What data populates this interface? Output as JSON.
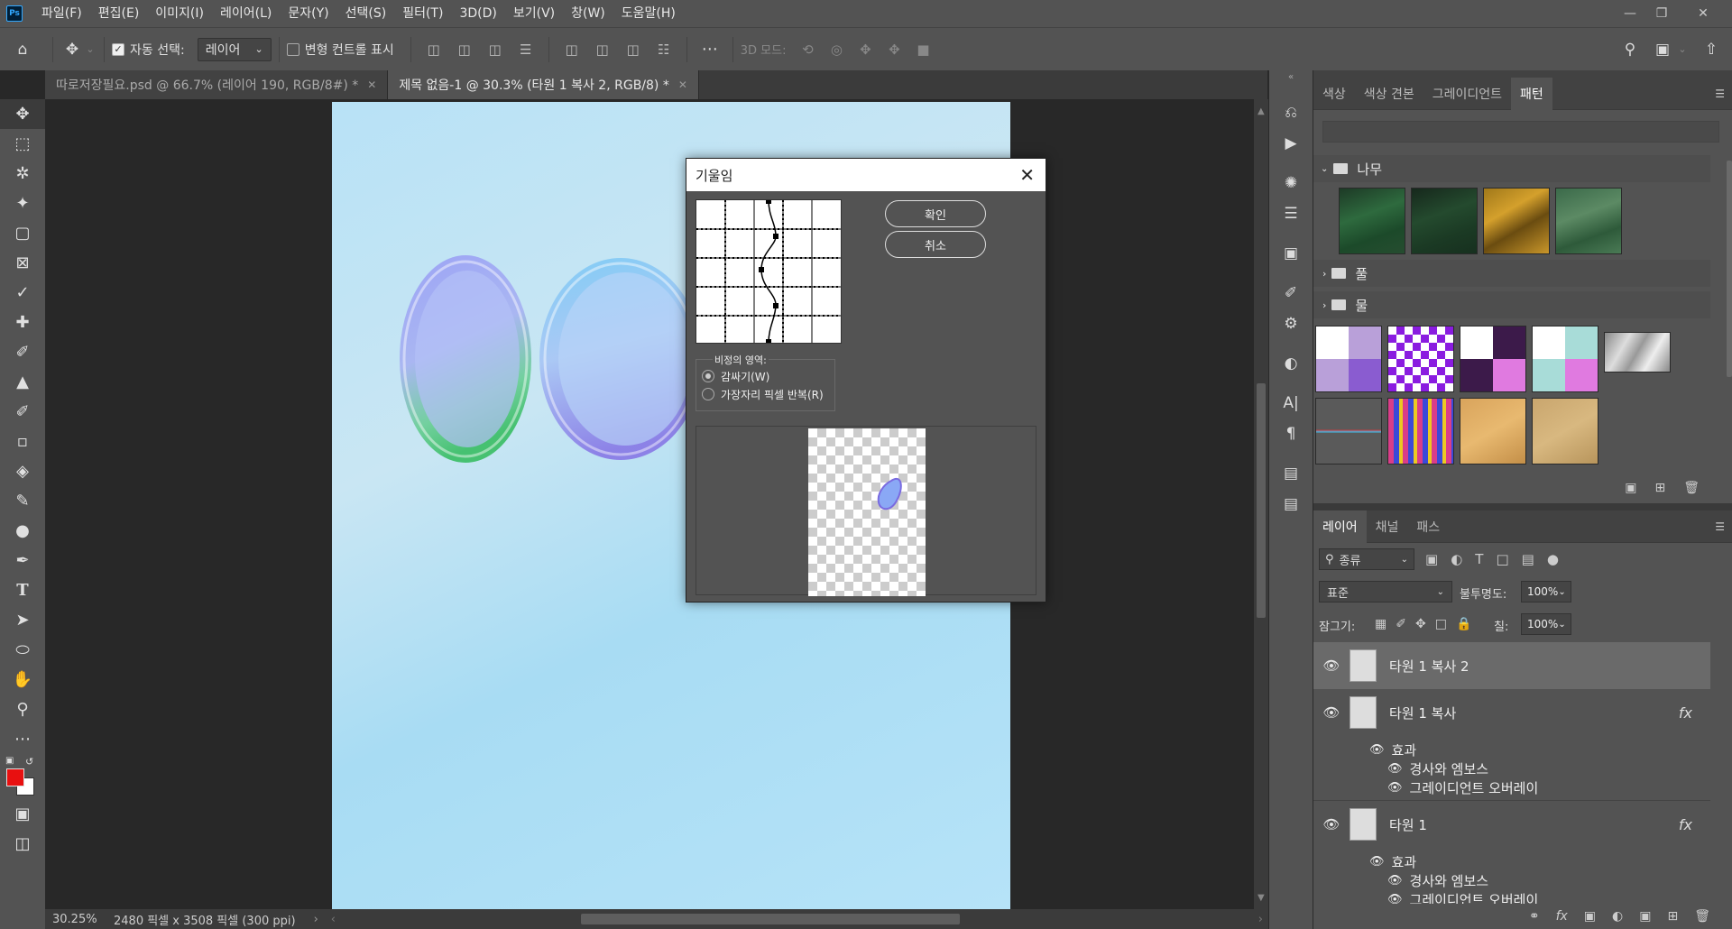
{
  "menubar": {
    "logo": "Ps",
    "items": [
      "파일(F)",
      "편집(E)",
      "이미지(I)",
      "레이어(L)",
      "문자(Y)",
      "선택(S)",
      "필터(T)",
      "3D(D)",
      "보기(V)",
      "창(W)",
      "도움말(H)"
    ]
  },
  "options": {
    "auto_select_label": "자동 선택:",
    "auto_select_value": "레이어",
    "transform_controls_label": "변형 컨트롤 표시",
    "mode_3d_label": "3D 모드:"
  },
  "tabs": [
    {
      "label": "따로저장필요.psd @ 66.7% (레이어 190, RGB/8#) *",
      "active": false
    },
    {
      "label": "제목 없음-1 @ 30.3% (타원 1 복사 2, RGB/8) *",
      "active": true
    }
  ],
  "status": {
    "zoom": "30.25%",
    "doc_info": "2480 픽셀 x 3508 픽셀 (300 ppi)"
  },
  "colors": {
    "foreground": "#e81010",
    "background": "#ffffff"
  },
  "dialog": {
    "title": "기울임",
    "ok_label": "확인",
    "cancel_label": "취소",
    "undefined_area_legend": "비정의 영역:",
    "option_wrap": "감싸기(W)",
    "option_repeat": "가장자리 픽셀 반복(R)",
    "selected_option": "감싸기(W)"
  },
  "swatch_panel": {
    "tabs": [
      "색상",
      "색상 견본",
      "그레이디언트",
      "패턴"
    ],
    "active_tab": "패턴",
    "groups": [
      "나무",
      "풀",
      "물"
    ]
  },
  "layers_panel": {
    "tabs": [
      "레이어",
      "채널",
      "패스"
    ],
    "active_tab": "레이어",
    "filter_label": "종류",
    "blend_mode": "표준",
    "opacity_label": "불투명도:",
    "opacity_value": "100%",
    "lock_label": "잠그기:",
    "fill_label": "칠:",
    "fill_value": "100%",
    "layers": [
      {
        "name": "타원 1 복사 2",
        "selected": true,
        "fx": ""
      },
      {
        "name": "타원 1 복사",
        "selected": false,
        "fx": "fx",
        "effects_label": "효과",
        "effects": [
          "경사와 엠보스",
          "그레이디언트 오버레이"
        ]
      },
      {
        "name": "타원 1",
        "selected": false,
        "fx": "fx",
        "effects_label": "효과",
        "effects": [
          "경사와 엠보스",
          "그레이디언트 오버레이"
        ]
      }
    ]
  }
}
